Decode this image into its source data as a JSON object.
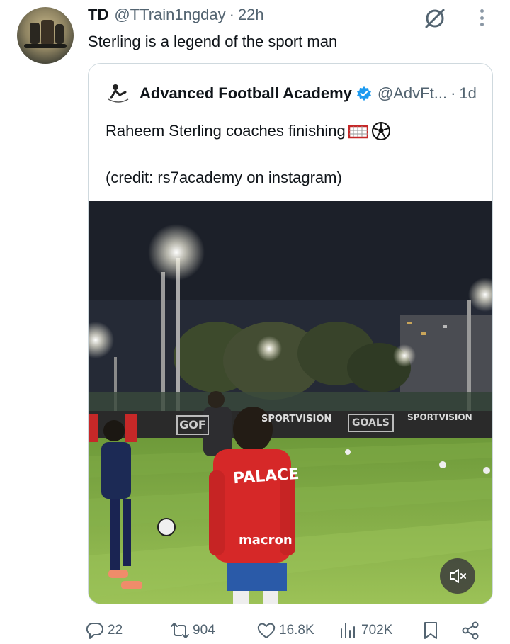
{
  "post": {
    "author_name": "TD",
    "author_handle": "@TTrain1ngday",
    "separator": "·",
    "time": "22h",
    "text": "Sterling is a legend of the sport man"
  },
  "quote": {
    "author_name": "Advanced Football Academy",
    "author_handle": "@AdvFt...",
    "separator": "·",
    "time": "1d",
    "text_line1": "Raheem Sterling coaches finishing",
    "text_line2": "(credit: rs7academy on instagram)",
    "video": {
      "boards": [
        "GOF",
        "SPORTVISION",
        "GOALS",
        "SPORTVISION"
      ],
      "jersey_text": "PALACE",
      "sponsor_text": "macron"
    }
  },
  "actions": {
    "replies": "22",
    "reposts": "904",
    "likes": "16.8K",
    "views": "702K"
  },
  "colors": {
    "text_primary": "#0f1419",
    "text_secondary": "#536471",
    "verified": "#1d9bf0",
    "border": "#cfd9de"
  }
}
